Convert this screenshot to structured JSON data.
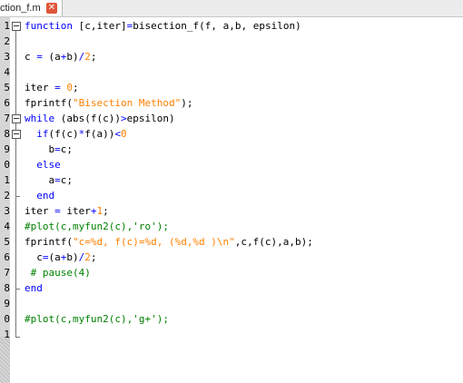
{
  "tab": {
    "title": "ction_f.m",
    "close_symbol": "✕"
  },
  "line_numbers": [
    "1",
    "2",
    "3",
    "4",
    "5",
    "6",
    "7",
    "8",
    "9",
    "0",
    "1",
    "2",
    "3",
    "4",
    "5",
    "6",
    "7",
    "8",
    "9",
    "0",
    "1"
  ],
  "code_lines": [
    "function [c,iter]=bisection_f(f, a,b, epsilon)",
    "",
    "c = (a+b)/2;",
    "",
    "iter = 0;",
    "fprintf(\"Bisection Method\");",
    "while (abs(f(c))>epsilon)",
    "  if(f(c)*f(a))<0",
    "    b=c;",
    "  else",
    "    a=c;",
    "  end",
    "iter = iter+1;",
    "#plot(c,myfun2(c),'ro');",
    "fprintf(\"c=%d, f(c)=%d, (%d,%d )\\n\",c,f(c),a,b);",
    "  c=(a+b)/2;",
    " # pause(4)",
    "end",
    "",
    "#plot(c,myfun2(c),'g+');",
    ""
  ],
  "colors": {
    "keyword": "#0000ff",
    "string": "#ff8000",
    "comment": "#008000",
    "close_button": "#e0563a"
  }
}
